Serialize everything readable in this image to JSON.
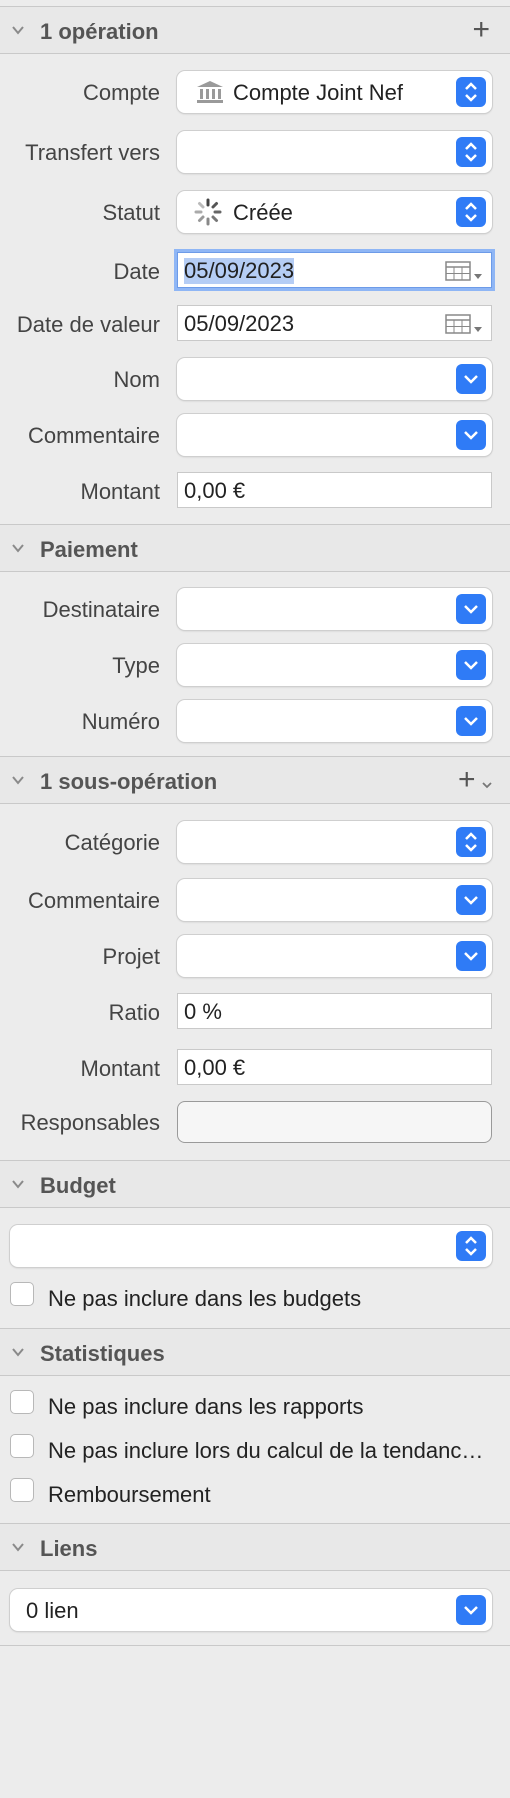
{
  "operation": {
    "header": "1 opération",
    "add_symbol": "+",
    "compte_label": "Compte",
    "compte_value": "Compte Joint Nef",
    "transfert_label": "Transfert vers",
    "transfert_value": "",
    "statut_label": "Statut",
    "statut_value": "Créée",
    "date_label": "Date",
    "date_value": "05/09/2023",
    "date_valeur_label": "Date de valeur",
    "date_valeur_value": "05/09/2023",
    "nom_label": "Nom",
    "commentaire_label": "Commentaire",
    "montant_label": "Montant",
    "montant_value": "0,00 €"
  },
  "paiement": {
    "header": "Paiement",
    "destinataire_label": "Destinataire",
    "type_label": "Type",
    "numero_label": "Numéro"
  },
  "sous_operation": {
    "header": "1 sous-opération",
    "add_symbol": "+",
    "categorie_label": "Catégorie",
    "commentaire_label": "Commentaire",
    "projet_label": "Projet",
    "ratio_label": "Ratio",
    "ratio_value": "0 %",
    "montant_label": "Montant",
    "montant_value": "0,00 €",
    "responsables_label": "Responsables"
  },
  "budget": {
    "header": "Budget",
    "exclude_label": "Ne pas inclure dans les budgets"
  },
  "statistiques": {
    "header": "Statistiques",
    "exclude_reports_label": "Ne pas inclure dans les rapports",
    "exclude_trend_label": "Ne pas inclure lors du calcul de la tendanc…",
    "reimbursement_label": "Remboursement"
  },
  "liens": {
    "header": "Liens",
    "value": "0 lien"
  },
  "colors": {
    "accent": "#2f7bf6",
    "selection": "#b5cdf5"
  }
}
